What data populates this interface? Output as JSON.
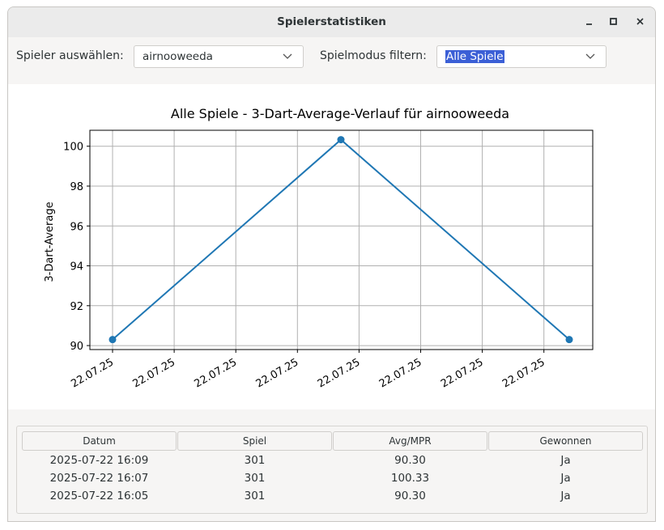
{
  "window": {
    "title": "Spielerstatistiken"
  },
  "toolbar": {
    "player_label": "Spieler auswählen:",
    "player_value": "airnooweeda",
    "mode_label": "Spielmodus filtern:",
    "mode_value": "Alle Spiele"
  },
  "chart_data": {
    "type": "line",
    "title": "Alle Spiele - 3-Dart-Average-Verlauf für airnooweeda",
    "xlabel": "",
    "ylabel": "3-Dart-Average",
    "x_tick_labels": [
      "22.07.25",
      "22.07.25",
      "22.07.25",
      "22.07.25",
      "22.07.25",
      "22.07.25",
      "22.07.25",
      "22.07.25"
    ],
    "y_ticks": [
      90,
      92,
      94,
      96,
      98,
      100
    ],
    "ylim": [
      89.8,
      100.8
    ],
    "grid": true,
    "series": [
      {
        "x": [
          "2025-07-22 16:05",
          "2025-07-22 16:07",
          "2025-07-22 16:09"
        ],
        "values": [
          90.3,
          100.33,
          90.3
        ],
        "color": "#1f77b4"
      }
    ]
  },
  "table": {
    "headers": [
      "Datum",
      "Spiel",
      "Avg/MPR",
      "Gewonnen"
    ],
    "rows": [
      [
        "2025-07-22 16:09",
        "301",
        "90.30",
        "Ja"
      ],
      [
        "2025-07-22 16:07",
        "301",
        "100.33",
        "Ja"
      ],
      [
        "2025-07-22 16:05",
        "301",
        "90.30",
        "Ja"
      ]
    ]
  }
}
